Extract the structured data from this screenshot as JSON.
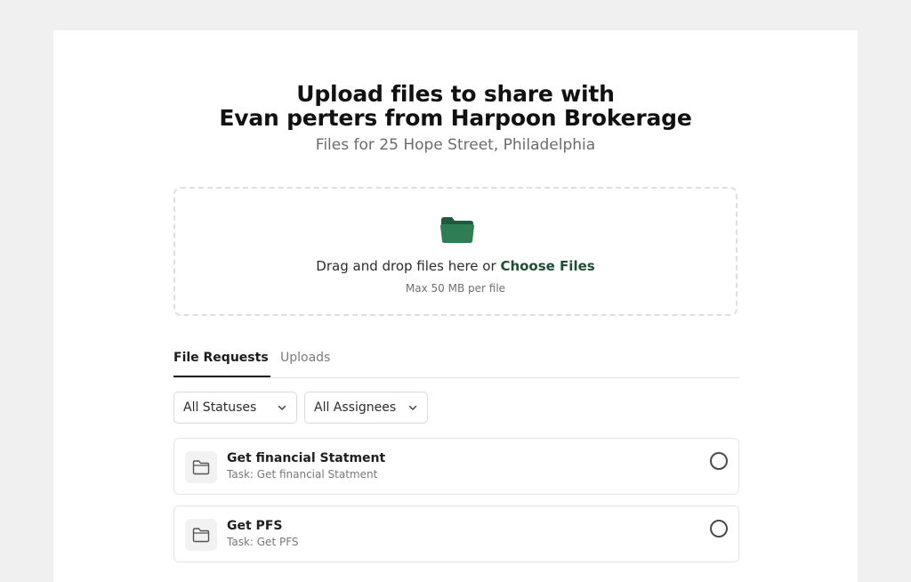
{
  "header": {
    "title_line1": "Upload files to share with",
    "title_line2": "Evan perters from Harpoon Brokerage",
    "subtitle": "Files for 25 Hope Street, Philadelphia"
  },
  "dropzone": {
    "icon": "folder-icon",
    "prompt": "Drag and drop files here or",
    "choose_label": "Choose Files",
    "hint": "Max 50 MB per file",
    "icon_color": "#2e7d54"
  },
  "tabs": [
    {
      "label": "File Requests",
      "active": true
    },
    {
      "label": "Uploads",
      "active": false
    }
  ],
  "filters": {
    "status": "All Statuses",
    "assignee": "All Assignees"
  },
  "requests": [
    {
      "title": "Get financial Statment",
      "subtitle": "Task: Get financial Statment"
    },
    {
      "title": "Get PFS",
      "subtitle": "Task: Get PFS"
    }
  ]
}
